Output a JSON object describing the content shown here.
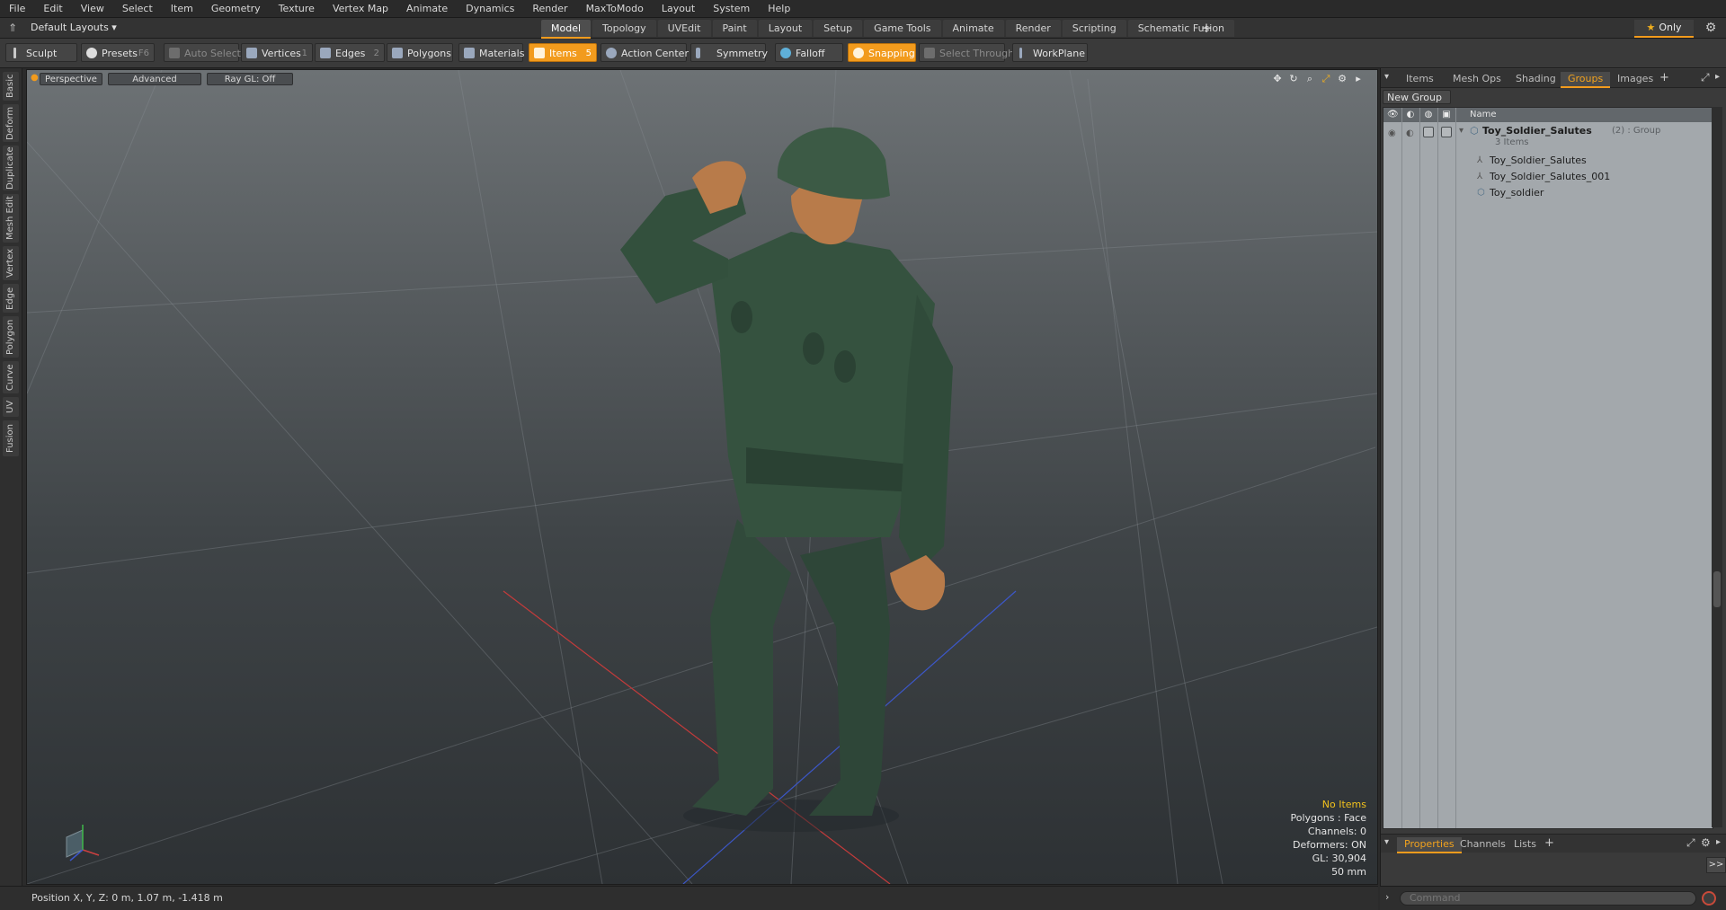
{
  "menu": [
    "File",
    "Edit",
    "View",
    "Select",
    "Item",
    "Geometry",
    "Texture",
    "Vertex Map",
    "Animate",
    "Dynamics",
    "Render",
    "MaxToModo",
    "Layout",
    "System",
    "Help"
  ],
  "layout_selector": "Default Layouts ▾",
  "mode_tabs": [
    "Model",
    "Topology",
    "UVEdit",
    "Paint",
    "Layout",
    "Setup",
    "Game Tools",
    "Animate",
    "Render",
    "Scripting",
    "Schematic Fusion"
  ],
  "active_mode_tab": "Model",
  "only_button": "Only",
  "toolbar": {
    "sculpt": "Sculpt",
    "presets": "Presets",
    "presets_key": "F6",
    "auto_select": "Auto Select",
    "vertices": "Vertices",
    "vertices_key": "1",
    "edges": "Edges",
    "edges_key": "2",
    "polygons": "Polygons",
    "materials": "Materials",
    "items": "Items",
    "items_key": "5",
    "action_center": "Action Center",
    "symmetry": "Symmetry",
    "falloff": "Falloff",
    "snapping": "Snapping",
    "select_through": "Select Through",
    "workplane": "WorkPlane"
  },
  "left_tabs": [
    "Basic",
    "Deform",
    "Duplicate",
    "Mesh Edit",
    "Vertex",
    "Edge",
    "Polygon",
    "Curve",
    "UV",
    "Fusion"
  ],
  "viewport": {
    "view_label": "Perspective",
    "shading_label": "Advanced",
    "raygl_label": "Ray GL: Off",
    "stats": {
      "selection": "No Items",
      "polygons": "Polygons : Face",
      "channels": "Channels: 0",
      "deformers": "Deformers: ON",
      "gl": "GL: 30,904",
      "lens": "50 mm"
    }
  },
  "right_panel": {
    "tabs": [
      "Items",
      "Mesh Ops",
      "Shading",
      "Groups",
      "Images"
    ],
    "active_tab": "Groups",
    "new_group_button": "New Group",
    "name_header": "Name",
    "group": {
      "name": "Toy_Soldier_Salutes",
      "suffix": "(2) : Group",
      "count": "3 Items",
      "children": [
        "Toy_Soldier_Salutes",
        "Toy_Soldier_Salutes_001",
        "Toy_soldier"
      ]
    },
    "bottom_tabs": [
      "Properties",
      "Channels",
      "Lists"
    ],
    "active_bottom_tab": "Properties",
    "expand_button": ">>"
  },
  "status": {
    "position": "Position X, Y, Z:  0 m, 1.07 m, -1.418 m"
  },
  "command_placeholder": "Command",
  "colors": {
    "accent": "#f29b1d",
    "highlight_text": "#f2c21d"
  }
}
